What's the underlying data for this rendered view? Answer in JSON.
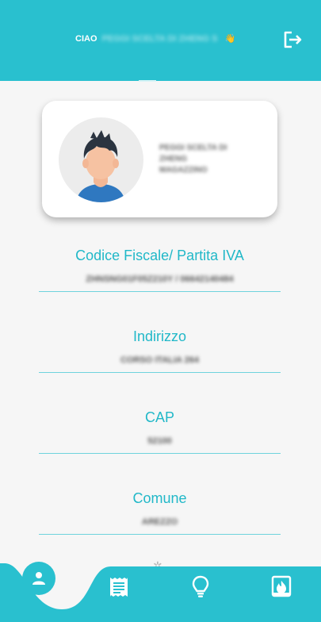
{
  "header": {
    "greeting": "CIAO",
    "user_name": "PEGGI SCELTA DI ZHENG S",
    "wave_emoji": "👋",
    "logout_icon": "logout-icon",
    "background_color": "#29c0cf"
  },
  "profile": {
    "name_line1": "PEGGI SCELTA DI",
    "name_line2": "ZHENG",
    "name_line3": "MAGAZZINO"
  },
  "fields": [
    {
      "label": "Codice Fiscale/ Partita IVA",
      "value": "ZHNSNG01F05Z210Y / 06642140484"
    },
    {
      "label": "Indirizzo",
      "value": "CORSO ITALIA 264"
    },
    {
      "label": "CAP",
      "value": "52100"
    },
    {
      "label": "Comune",
      "value": "AREZZO"
    }
  ],
  "bottom_nav": {
    "items": [
      {
        "icon": "user-icon",
        "active": true
      },
      {
        "icon": "receipt-icon",
        "active": false
      },
      {
        "icon": "lightbulb-icon",
        "active": false
      },
      {
        "icon": "gas-flame-icon",
        "active": false
      }
    ],
    "accent_color": "#29c0cf"
  }
}
